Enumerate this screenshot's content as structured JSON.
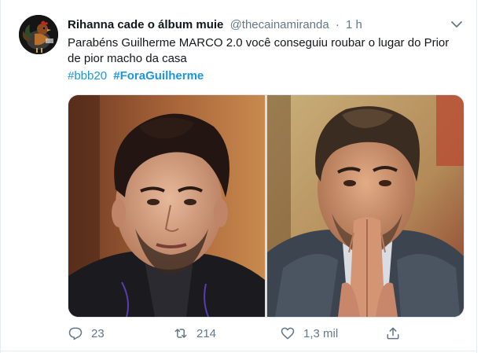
{
  "tweet": {
    "display_name": "Rihanna cade o álbum muie",
    "handle": "@thecainamiranda",
    "separator": "·",
    "timestamp": "1 h",
    "text": "Parabéns Guilherme MARCO 2.0 você conseguiu roubar o lugar do Prior de pior macho da casa",
    "hashtags": [
      "#bbb20",
      "#ForaGuilherme"
    ]
  },
  "actions": {
    "replies": "23",
    "retweets": "214",
    "likes": "1,3 mil"
  },
  "colors": {
    "accent": "#1b95e0",
    "secondary_text": "#657786",
    "primary_text": "#14171a"
  },
  "icons": [
    "rooster-avatar",
    "chevron-down-icon",
    "reply-icon",
    "retweet-icon",
    "heart-icon",
    "share-icon"
  ]
}
